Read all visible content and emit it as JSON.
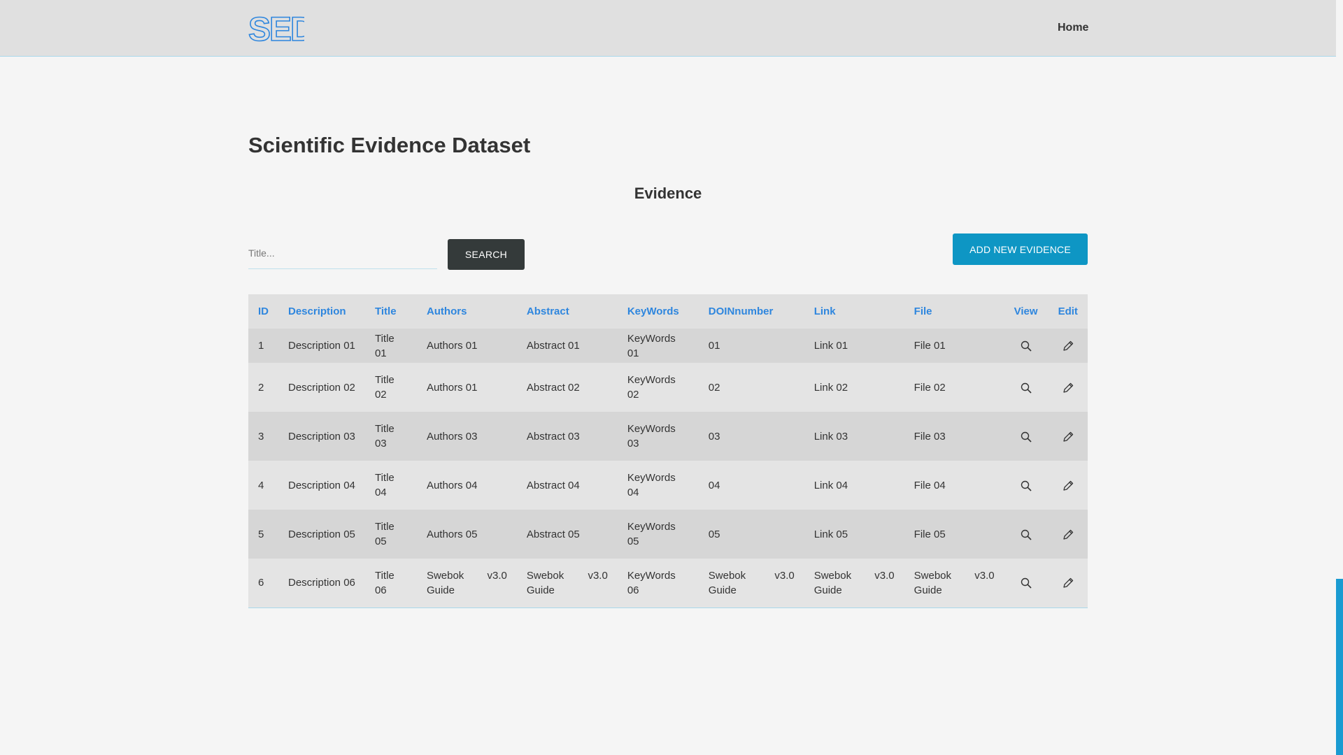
{
  "header": {
    "logo_text": "SED",
    "nav_home": "Home"
  },
  "page": {
    "title": "Scientific Evidence Dataset",
    "section_title": "Evidence"
  },
  "search": {
    "placeholder": "Title...",
    "value": "",
    "button_label": "SEARCH"
  },
  "add_button_label": "ADD NEW EVIDENCE",
  "colors": {
    "header_link": "#2e86de",
    "add_button": "#0e96c4",
    "search_button": "#343a3a"
  },
  "table": {
    "columns": [
      "ID",
      "Description",
      "Title",
      "Authors",
      "Abstract",
      "KeyWords",
      "DOINnumber",
      "Link",
      "File",
      "View",
      "Edit"
    ],
    "row_icons": {
      "view": "search-icon",
      "edit": "pencil-icon"
    },
    "rows": [
      {
        "id": "1",
        "description": "Description 01",
        "title": "Title 01",
        "authors": "Authors 01",
        "abstract": "Abstract 01",
        "keywords": "KeyWords 01",
        "doi": "01",
        "link": "Link 01",
        "file": "File 01"
      },
      {
        "id": "2",
        "description": "Description 02",
        "title": "Title 02",
        "authors": "Authors 01",
        "abstract": "Abstract 02",
        "keywords": "KeyWords 02",
        "doi": "02",
        "link": "Link 02",
        "file": "File 02"
      },
      {
        "id": "3",
        "description": "Description 03",
        "title": "Title 03",
        "authors": "Authors 03",
        "abstract": "Abstract 03",
        "keywords": "KeyWords 03",
        "doi": "03",
        "link": "Link 03",
        "file": "File 03"
      },
      {
        "id": "4",
        "description": "Description 04",
        "title": "Title 04",
        "authors": "Authors 04",
        "abstract": "Abstract 04",
        "keywords": "KeyWords 04",
        "doi": "04",
        "link": "Link 04",
        "file": "File 04"
      },
      {
        "id": "5",
        "description": "Description 05",
        "title": "Title 05",
        "authors": "Authors 05",
        "abstract": "Abstract 05",
        "keywords": "KeyWords 05",
        "doi": "05",
        "link": "Link 05",
        "file": "File 05"
      },
      {
        "id": "6",
        "description": "Description 06",
        "title": "Title 06",
        "authors": "Swebok Guide",
        "authors_version": "v3.0",
        "abstract": "Swebok Guide",
        "abstract_version": "v3.0",
        "keywords": "KeyWords 06",
        "doi": "Swebok Guide",
        "doi_version": "v3.0",
        "link": "Swebok Guide",
        "link_version": "v3.0",
        "file": "Swebok Guide",
        "file_version": "v3.0"
      }
    ]
  }
}
